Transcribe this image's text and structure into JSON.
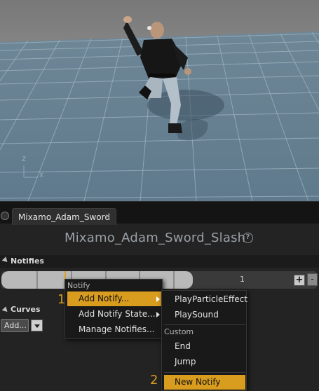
{
  "viewport": {
    "axes": {
      "z": "Z",
      "x": "X"
    }
  },
  "tab": {
    "title": "Mixamo_Adam_Sword",
    "close": "×"
  },
  "animation": {
    "title": "Mixamo_Adam_Sword_Slash",
    "help": "?"
  },
  "notifies_section": {
    "label": "Notifies"
  },
  "track": {
    "count": "1",
    "plus": "+",
    "minus": "-"
  },
  "curves_section": {
    "label": "Curves",
    "add_label": "Add..."
  },
  "steps": {
    "one": "1",
    "two": "2"
  },
  "context_menu": {
    "heading": "Notify",
    "items": [
      {
        "label": "Add Notify...",
        "has_submenu": true,
        "highlighted": true
      },
      {
        "label": "Add Notify State...",
        "has_submenu": true,
        "highlighted": false
      },
      {
        "label": "Manage Notifies...",
        "has_submenu": false,
        "highlighted": false
      }
    ]
  },
  "submenu": {
    "items": [
      "PlayParticleEffect",
      "PlaySound"
    ],
    "custom_heading": "Custom",
    "custom_items": [
      "End",
      "Jump"
    ],
    "new_notify": "New Notify"
  },
  "colors": {
    "highlight": "#d89c1e",
    "step_number": "#d89a1e"
  }
}
